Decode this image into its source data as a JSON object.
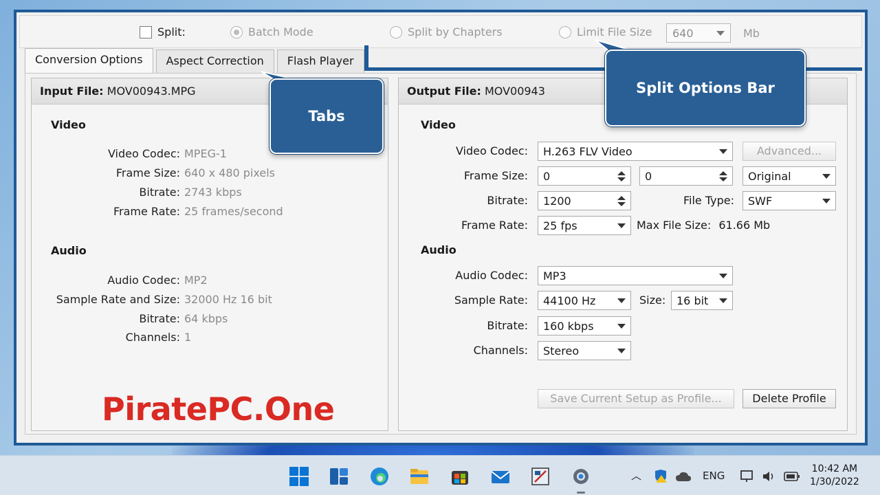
{
  "split_bar": {
    "split_label": "Split:",
    "batch_mode_label": "Batch Mode",
    "split_by_chapters_label": "Split by Chapters",
    "limit_file_size_label": "Limit File Size",
    "limit_value": "640",
    "limit_unit": "Mb"
  },
  "tabs": [
    {
      "label": "Conversion Options"
    },
    {
      "label": "Aspect Correction"
    },
    {
      "label": "Flash Player"
    }
  ],
  "input": {
    "header_label": "Input File:",
    "header_file": "MOV00943.MPG",
    "video_title": "Video",
    "video": [
      {
        "key": "Video Codec:",
        "value": "MPEG-1"
      },
      {
        "key": "Frame Size:",
        "value": "640 x 480 pixels"
      },
      {
        "key": "Bitrate:",
        "value": "2743 kbps"
      },
      {
        "key": "Frame Rate:",
        "value": "25 frames/second"
      }
    ],
    "audio_title": "Audio",
    "audio": [
      {
        "key": "Audio Codec:",
        "value": "MP2"
      },
      {
        "key": "Sample Rate and Size:",
        "value": "32000 Hz 16 bit"
      },
      {
        "key": "Bitrate:",
        "value": "64 kbps"
      },
      {
        "key": "Channels:",
        "value": "1"
      }
    ]
  },
  "output": {
    "header_label": "Output File:",
    "header_file": "MOV00943",
    "video_title": "Video",
    "video_codec_label": "Video Codec:",
    "video_codec_value": "H.263 FLV Video",
    "advanced_label": "Advanced...",
    "frame_size_label": "Frame Size:",
    "frame_w": "0",
    "frame_h": "0",
    "aspect_value": "Original",
    "bitrate_label": "Bitrate:",
    "bitrate_value": "1200",
    "file_type_label": "File Type:",
    "file_type_value": "SWF",
    "frame_rate_label": "Frame Rate:",
    "frame_rate_value": "25 fps",
    "max_file_size_label": "Max File Size:",
    "max_file_size_value": "61.66 Mb",
    "audio_title": "Audio",
    "audio_codec_label": "Audio Codec:",
    "audio_codec_value": "MP3",
    "sample_rate_label": "Sample Rate:",
    "sample_rate_value": "44100 Hz",
    "size_label": "Size:",
    "size_value": "16 bit",
    "audio_bitrate_label": "Bitrate:",
    "audio_bitrate_value": "160 kbps",
    "channels_label": "Channels:",
    "channels_value": "Stereo",
    "save_profile_label": "Save Current Setup as Profile...",
    "delete_profile_label": "Delete Profile"
  },
  "callouts": {
    "tabs": "Tabs",
    "split_options": "Split Options Bar"
  },
  "watermark": "PiratePC.One",
  "taskbar": {
    "language": "ENG",
    "time": "10:42 AM",
    "date": "1/30/2022"
  },
  "colors": {
    "frame_blue": "#1f5a96",
    "callout_blue": "#2a5f95",
    "watermark_red": "#d92a23"
  }
}
